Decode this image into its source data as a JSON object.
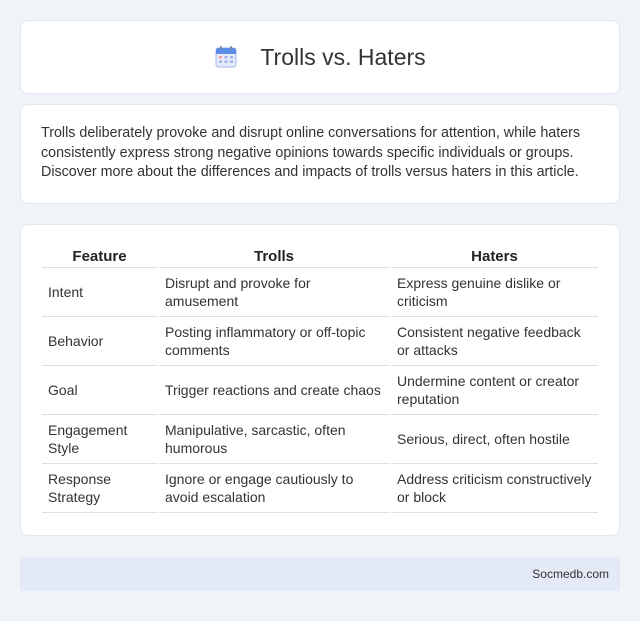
{
  "header": {
    "title": "Trolls vs. Haters",
    "icon": "calendar-icon"
  },
  "intro": {
    "text": "Trolls deliberately provoke and disrupt online conversations for attention, while haters consistently express strong negative opinions towards specific individuals or groups. Discover more about the differences and impacts of trolls versus haters in this article."
  },
  "table": {
    "headers": [
      "Feature",
      "Trolls",
      "Haters"
    ],
    "rows": [
      [
        "Intent",
        "Disrupt and provoke for amusement",
        "Express genuine dislike or criticism"
      ],
      [
        "Behavior",
        "Posting inflammatory or off-topic comments",
        "Consistent negative feedback or attacks"
      ],
      [
        "Goal",
        "Trigger reactions and create chaos",
        "Undermine content or creator reputation"
      ],
      [
        "Engagement Style",
        "Manipulative, sarcastic, often humorous",
        "Serious, direct, often hostile"
      ],
      [
        "Response Strategy",
        "Ignore or engage cautiously to avoid escalation",
        "Address criticism constructively or block"
      ]
    ]
  },
  "footer": {
    "text": "Socmedb.com"
  },
  "colors": {
    "background": "#f0f3f8",
    "card": "#ffffff",
    "footer_bg": "#e4e9f6",
    "icon_blue": "#5b8de8"
  }
}
